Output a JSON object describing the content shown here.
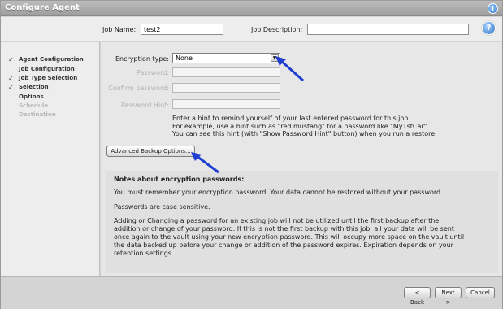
{
  "window": {
    "title": "Configure Agent"
  },
  "job": {
    "name_label": "Job Name:",
    "name_value": "test2",
    "description_label": "Job Description:",
    "description_value": ""
  },
  "sidebar": {
    "steps": [
      {
        "label": "Agent Configuration",
        "checked": true,
        "enabled": true
      },
      {
        "label": "Job Configuration",
        "checked": false,
        "enabled": true
      },
      {
        "label": "Job Type Selection",
        "checked": true,
        "enabled": true
      },
      {
        "label": "Selection",
        "checked": true,
        "enabled": true
      },
      {
        "label": "Options",
        "checked": false,
        "enabled": true
      },
      {
        "label": "Schedule",
        "checked": false,
        "enabled": false
      },
      {
        "label": "Destination",
        "checked": false,
        "enabled": false
      }
    ],
    "check_glyph": "✓"
  },
  "form": {
    "encryption_label": "Encryption type:",
    "encryption_value": "None",
    "password_label": "Password:",
    "confirm_label": "Confirm password:",
    "hint_label": "Password Hint:",
    "hint_help": [
      "Enter a hint to remind yourself of your last entered password for this job.",
      "For example, use a hint such as \"red mustang\" for a password like \"My1stCar\".",
      "You can see this hint (with \"Show Password Hint\" button) when you run a restore."
    ],
    "advanced_button": "Advanced Backup Options..."
  },
  "notes": {
    "heading": "Notes about encryption passwords:",
    "p1": "You must remember your encryption password. Your data cannot be restored without your password.",
    "p2": "Passwords are case sensitive.",
    "p3_lines": [
      "Adding or Changing a password for an existing job will not be utilized until the first backup after the",
      "addition or change of your password. If this is not the first backup with this job, all your data will be sent",
      "once again to the vault using your new encryption password. This will occupy more space on the vault until",
      "the data backed up before your change or addition of the password expires. Expiration depends on your",
      "retention settings."
    ]
  },
  "footer": {
    "back": "< Back",
    "next": "Next >",
    "cancel": "Cancel"
  },
  "colors": {
    "arrow": "#1f3fd0",
    "title_bar": "#a8a8a8",
    "help_icon": "#2c6fc4"
  },
  "icons": {
    "info": "info-icon",
    "help": "help-icon",
    "dropdown": "chevron-down-icon"
  }
}
